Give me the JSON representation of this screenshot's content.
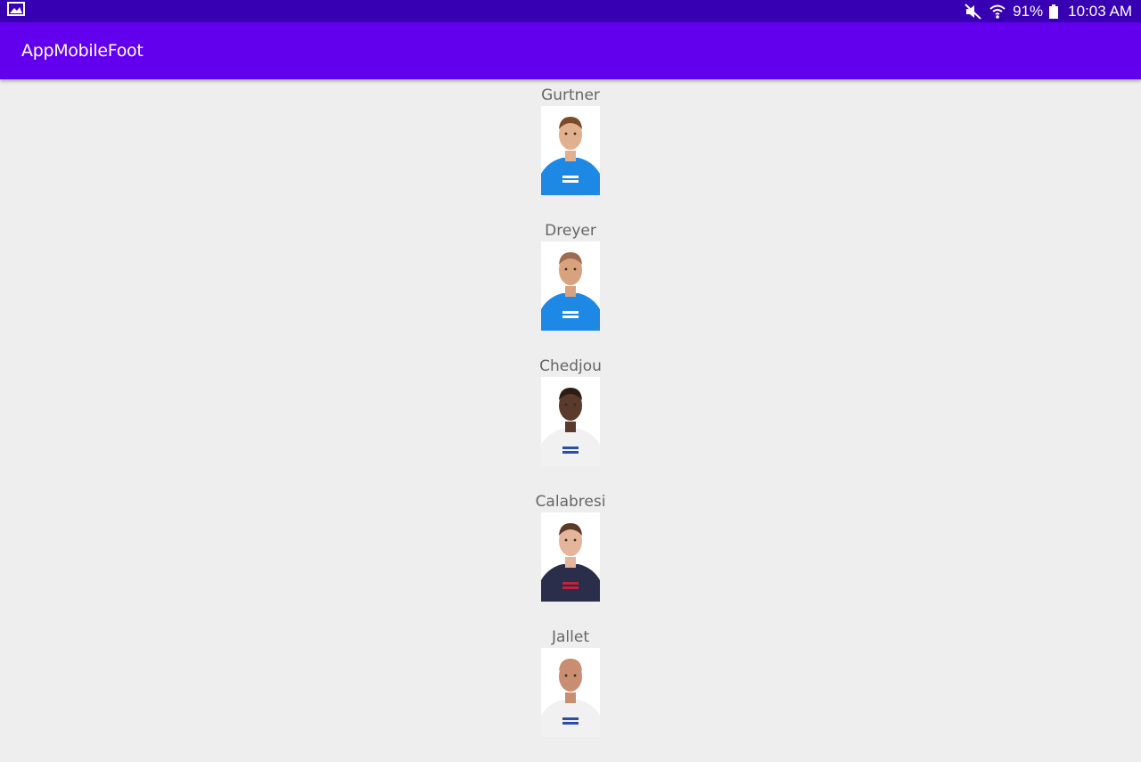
{
  "status_bar": {
    "battery": "91%",
    "time": "10:03 AM",
    "icons": [
      "image-icon",
      "mute-icon",
      "wifi-icon",
      "battery-icon"
    ]
  },
  "app_bar": {
    "title": "AppMobileFoot"
  },
  "players": [
    {
      "name": "Gurtner",
      "jersey": "#1e88e5",
      "skin": "#e0b08f",
      "hair": "#7a4a2a",
      "jersey_text": "#ffffff"
    },
    {
      "name": "Dreyer",
      "jersey": "#1e88e5",
      "skin": "#d9a27f",
      "hair": "#9c6b50",
      "jersey_text": "#ffffff"
    },
    {
      "name": "Chedjou",
      "jersey": "#f1f1f1",
      "skin": "#5a3a2a",
      "hair": "#2b1d16",
      "jersey_text": "#2b4ea8"
    },
    {
      "name": "Calabresi",
      "jersey": "#2a2e4a",
      "skin": "#e4b59a",
      "hair": "#5a3b28",
      "jersey_text": "#c4213a"
    },
    {
      "name": "Jallet",
      "jersey": "#f1f1f1",
      "skin": "#c98d72",
      "hair": "#c98d72",
      "jersey_text": "#2b4ea8"
    }
  ]
}
